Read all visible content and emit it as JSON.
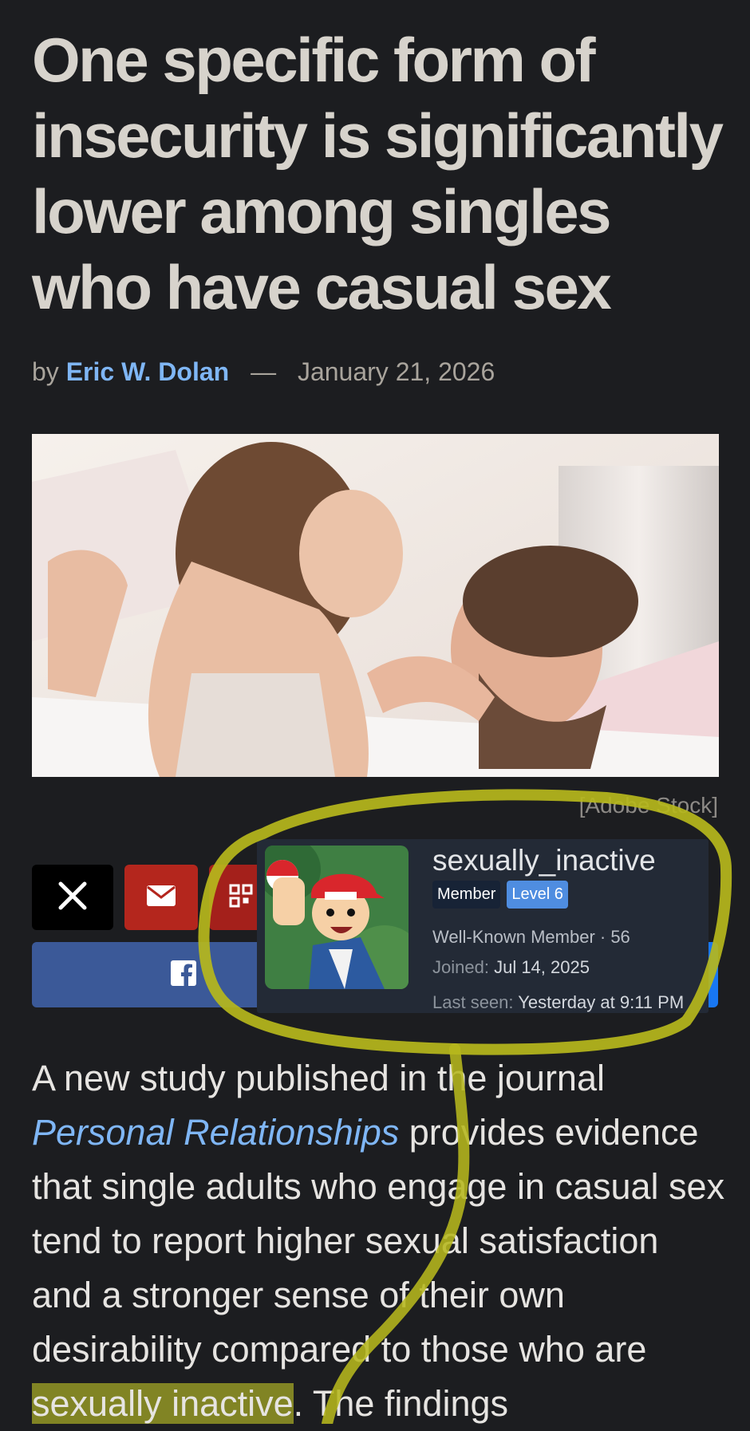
{
  "article": {
    "title": "One specific form of insecurity is significantly lower among singles who have casual sex",
    "byline": {
      "prefix": "by",
      "author": "Eric W. Dolan",
      "separator": "—",
      "date": "January 21, 2026"
    },
    "image_credit": "[Adobe Stock]",
    "body": {
      "part1": "A new study published in the journal ",
      "journal": "Personal Relationships",
      "part2": " provides evidence that single adults who engage in casual sex tend to report higher sexual satisfaction and a stronger sense of their own desirability compared to those who are ",
      "highlight": "sexually inactive",
      "part3": ". The findings"
    }
  },
  "share": {
    "x_icon": "x-logo-icon",
    "mail_icon": "envelope-icon",
    "qr_icon": "qr-code-icon",
    "facebook_icon": "facebook-icon"
  },
  "member_card": {
    "username": "sexually_inactive",
    "badges": [
      "Member",
      "Level 6"
    ],
    "title_line": "Well-Known Member · 56",
    "joined_label": "Joined:",
    "joined_value": "Jul 14, 2025",
    "last_seen_label": "Last seen:",
    "last_seen_value": "Yesterday at 9:11 PM"
  },
  "colors": {
    "background": "#1c1d20",
    "link": "#7fb6f5",
    "annotation": "#b6b71c",
    "card_bg": "#232a36"
  }
}
